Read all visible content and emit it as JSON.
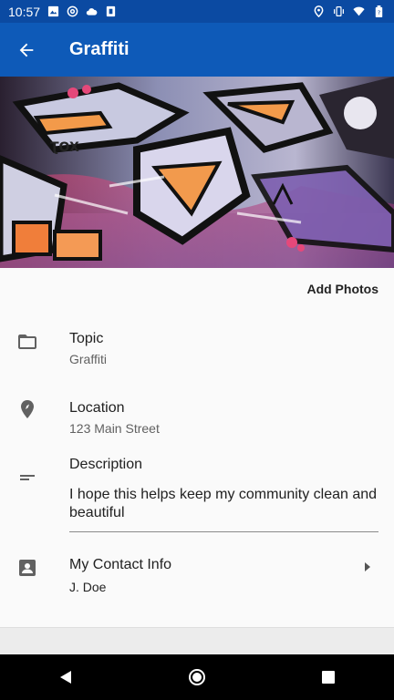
{
  "status_bar": {
    "time": "10:57",
    "left_icons": [
      "image-icon",
      "at-sign-icon",
      "cloud-icon",
      "sim-icon"
    ],
    "right_icons": [
      "location-icon",
      "vibrate-icon",
      "wifi-icon",
      "battery-icon"
    ]
  },
  "app_bar": {
    "title": "Graffiti",
    "back_icon": "arrow-back-icon",
    "color": "#0e5ab8"
  },
  "hero": {
    "image": "graffiti-photo"
  },
  "add_photos_label": "Add Photos",
  "topic": {
    "label": "Topic",
    "value": "Graffiti",
    "icon": "folder-icon"
  },
  "location": {
    "label": "Location",
    "value": "123 Main Street",
    "icon": "location-pin-icon"
  },
  "description": {
    "label": "Description",
    "value": "I hope this helps keep my community clean and beautiful",
    "icon": "short-text-icon"
  },
  "contact": {
    "label": "My Contact Info",
    "value": "J. Doe",
    "icon": "contact-card-icon"
  },
  "nav_bar": {
    "icons": [
      "back-triangle-icon",
      "home-circle-icon",
      "recents-square-icon"
    ]
  }
}
